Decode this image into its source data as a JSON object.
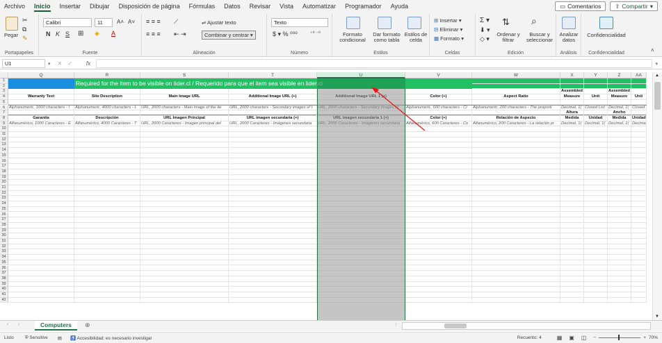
{
  "menu": {
    "tabs": [
      "Archivo",
      "Inicio",
      "Insertar",
      "Dibujar",
      "Disposición de página",
      "Fórmulas",
      "Datos",
      "Revisar",
      "Vista",
      "Automatizar",
      "Programador",
      "Ayuda"
    ],
    "active": "Inicio",
    "comments": "Comentarios",
    "share": "Compartir"
  },
  "ribbon": {
    "clipboard": {
      "paste": "Pegar",
      "label": "Portapapeles"
    },
    "font": {
      "name": "Calibri",
      "size": "11",
      "label": "Fuente",
      "bold": "N",
      "italic": "K",
      "underline": "S"
    },
    "alignment": {
      "wrap": "Ajustar texto",
      "merge": "Combinar y centrar",
      "label": "Alineación"
    },
    "number": {
      "format": "Texto",
      "label": "Número"
    },
    "styles": {
      "conditional": "Formato condicional",
      "table": "Dar formato como tabla",
      "cell": "Estilos de celda",
      "label": "Estilos"
    },
    "cells": {
      "insert": "Insertar",
      "delete": "Eliminar",
      "format": "Formato",
      "label": "Celdas"
    },
    "editing": {
      "sort": "Ordenar y filtrar",
      "find": "Buscar y seleccionar",
      "label": "Edición"
    },
    "analysis": {
      "analyze": "Analizar datos",
      "label": "Análisis"
    },
    "sensitivity": {
      "confidential": "Confidencialidad",
      "label": "Confidencialidad"
    }
  },
  "formula_bar": {
    "namebox": "U1",
    "fx": "fx",
    "content": ""
  },
  "columns": [
    "Q",
    "R",
    "S",
    "T",
    "U",
    "V",
    "W",
    "X",
    "Y",
    "Z",
    "AA"
  ],
  "banner_text": "Required for the item to be visible on lider.cl / Requerido para que el item sea visible en lider.cl",
  "rows": {
    "r3": {
      "X": "Assembled Product",
      "Z": "Assembled Product"
    },
    "r4": {
      "Q": "Warranty Text",
      "R": "Site Description",
      "S": "Main Image URL",
      "T": "Additional Image URL (+)",
      "U": "Additional Image URL 1 (+)",
      "V": "Color (+)",
      "W": "Aspect Ratio",
      "X": "Measure",
      "Y": "Unit",
      "Z": "Measure",
      "AA": "Unit"
    },
    "r6": {
      "Q": "Alphanumeric, 1000 characters - I",
      "R": "Alphanumeric, 4000 characters - L",
      "S": "URL, 2000 characters - Main image of the ite",
      "T": "URL, 2000 characters - Secondary images of t",
      "U": "URL, 2000 characters - Secondary images of",
      "V": "Alphanumeric, 600 characters - Cl",
      "W": "Alphanumeric, 200 characters - The proporti",
      "X": "Decimal, 1(",
      "Y": "Closed List",
      "Z": "Decimal, 1(",
      "AA": "Closed List"
    },
    "r7": {
      "X": "Altura",
      "Z": "Ancho"
    },
    "r8": {
      "Q": "Garantía",
      "R": "Descripción",
      "S": "URL Imagen Principal",
      "T": "URL imagen secundaria (+)",
      "U": "URL imagen secundaria 1 (+)",
      "V": "Color (+)",
      "W": "Relación de Aspecto",
      "X": "Medida",
      "Y": "Unidad",
      "Z": "Medida",
      "AA": "Unidad"
    },
    "r9": {
      "Q": "Alfanumérico, 1000 Caracteres - E",
      "R": "Alfanumérico, 4000 Caracteres - T",
      "S": "URL, 2000 Caracteres - Imagen principal del",
      "T": "URL, 2000 Caracteres - Imágenes secundaria",
      "U": "URL, 2000 Caracteres - Imágenes secundaria",
      "V": "Alfanumérico, 600 Caracteres - Co",
      "W": "Alfanumérico, 200 Caracteres - La relación pr",
      "X": "Decimal, 1(",
      "Y": "Decimal, 1(",
      "Z": "Decimal, 1(",
      "AA": "Decimal, 1("
    }
  },
  "row_numbers": [
    "1",
    "2",
    "3",
    "4",
    "5",
    "6",
    "7",
    "8",
    "9",
    "10",
    "11",
    "12",
    "13",
    "14",
    "15",
    "16",
    "17",
    "18",
    "19",
    "20",
    "21",
    "22",
    "23",
    "24",
    "25",
    "26",
    "27",
    "28",
    "29",
    "30",
    "31",
    "32",
    "33",
    "34",
    "35",
    "36",
    "37",
    "38",
    "39",
    "40",
    "41",
    "42"
  ],
  "sheet_tab": "Computers",
  "status": {
    "ready": "Listo",
    "sensitive": "Sensitive",
    "accessibility": "Accesibilidad: es necesario investigar",
    "count": "Recuento: 4",
    "zoom": "70%"
  },
  "colors": {
    "accent": "#217346",
    "banner": "#21c063",
    "blue": "#1a8fe0"
  }
}
